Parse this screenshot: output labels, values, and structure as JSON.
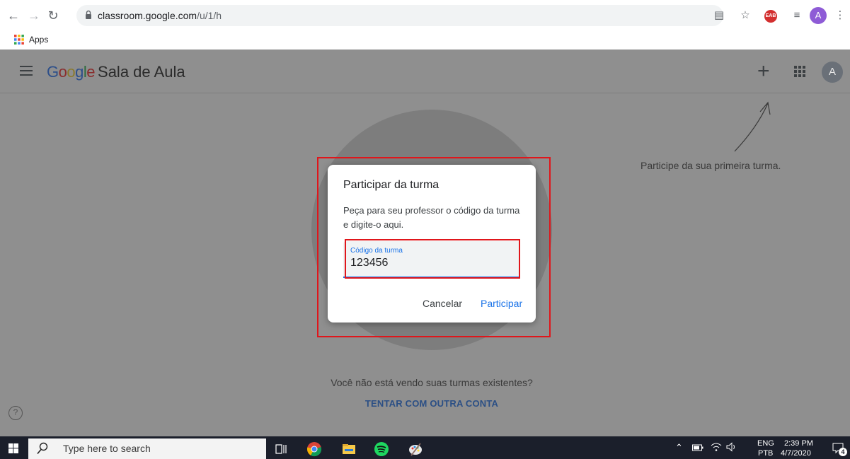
{
  "browser": {
    "url_host": "classroom.google.com",
    "url_path": "/u/1/h",
    "bookmark_apps_label": "Apps",
    "profile_initial": "A",
    "lastpass_label": "EAB"
  },
  "appbar": {
    "logo_word": [
      "G",
      "o",
      "o",
      "g",
      "l",
      "e"
    ],
    "product_name": "Sala de Aula",
    "account_initial": "A"
  },
  "page": {
    "hint": "Participe da sua primeira turma.",
    "existing_question": "Você não está vendo suas turmas existentes?",
    "switch_account": "TENTAR COM OUTRA CONTA",
    "help_glyph": "?"
  },
  "dialog": {
    "title": "Participar da turma",
    "body": "Peça para seu professor o código da turma e digite-o aqui.",
    "field_label": "Código da turma",
    "field_value": "123456",
    "cancel_label": "Cancelar",
    "join_label": "Participar"
  },
  "taskbar": {
    "search_placeholder": "Type here to search",
    "lang_top": "ENG",
    "lang_bottom": "PTB",
    "time": "2:39 PM",
    "date": "4/7/2020",
    "notification_count": "4"
  },
  "colors": {
    "highlight": "#e0161b",
    "accent": "#1a73e8",
    "overlay": "#8f8f8f"
  }
}
